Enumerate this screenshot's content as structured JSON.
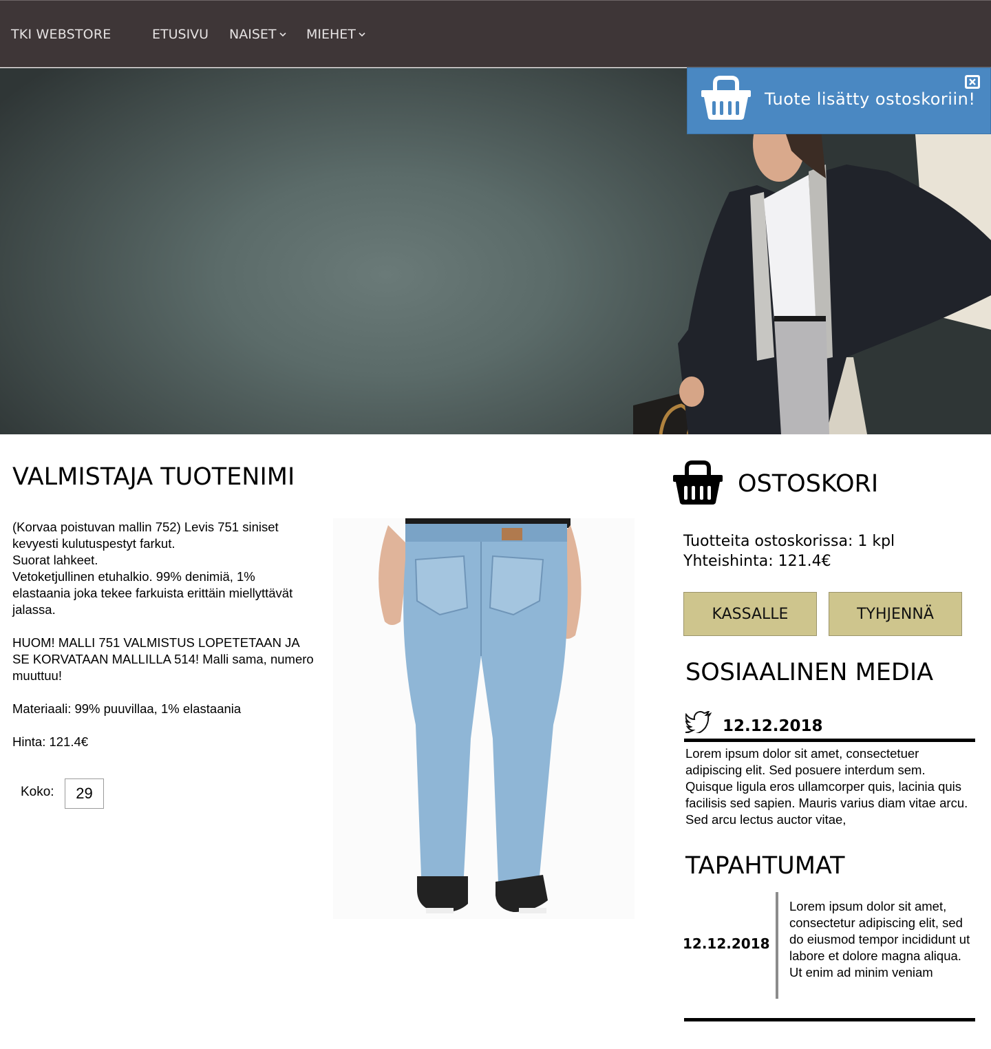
{
  "nav": {
    "brand": "TKI WEBSTORE",
    "items": [
      {
        "label": "ETUSIVU"
      },
      {
        "label": "NAISET",
        "icon": "chevron-down-icon"
      },
      {
        "label": "MIEHET",
        "icon": "chevron-down-icon"
      }
    ],
    "background": "#3e3637"
  },
  "toast": {
    "message": "Tuote lisätty ostoskoriin!",
    "icon": "basket-icon",
    "close_icon": "close-icon",
    "background": "#4a88c2"
  },
  "product": {
    "title": "VALMISTAJA TUOTENIMI",
    "description": [
      "(Korvaa poistuvan mallin 752) Levis 751 siniset kevyesti kulutuspestyt farkut.",
      "Suorat lahkeet.",
      "Vetoketjullinen etuhalkio. 99% denimiä, 1% elastaania joka tekee farkuista erittäin miellyttävät jalassa."
    ],
    "notice": "HUOM! MALLI 751 VALMISTUS LOPETETAAN JA SE KORVATAAN MALLILLA 514! Malli sama, numero muuttuu!",
    "material": "Materiaali: 99% puuvillaa, 1% elastaania",
    "price": "Hinta: 121.4€",
    "size_label": "Koko:",
    "size_value": "29"
  },
  "cart": {
    "title": "OSTOSKORI",
    "icon": "basket-icon",
    "items_line": "Tuotteita ostoskorissa: 1 kpl",
    "total_line": "Yhteishinta: 121.4€",
    "checkout_label": "KASSALLE",
    "empty_label": "TYHJENNÄ",
    "button_color": "#cec58d"
  },
  "social": {
    "title": "SOSIAALINEN MEDIA",
    "icon": "twitter-icon",
    "date": "12.12.2018",
    "text": "Lorem ipsum dolor sit amet, consectetuer adipiscing elit. Sed posuere interdum sem. Quisque ligula eros ullamcorper quis, lacinia quis facilisis sed sapien. Mauris varius diam vitae arcu. Sed arcu lectus auctor vitae,"
  },
  "events": {
    "title": "TAPAHTUMAT",
    "date": "12.12.2018",
    "text": "Lorem ipsum dolor sit amet, consectetur adipiscing elit, sed do eiusmod tempor incididunt ut labore et dolore magna aliqua. Ut enim ad minim veniam"
  }
}
